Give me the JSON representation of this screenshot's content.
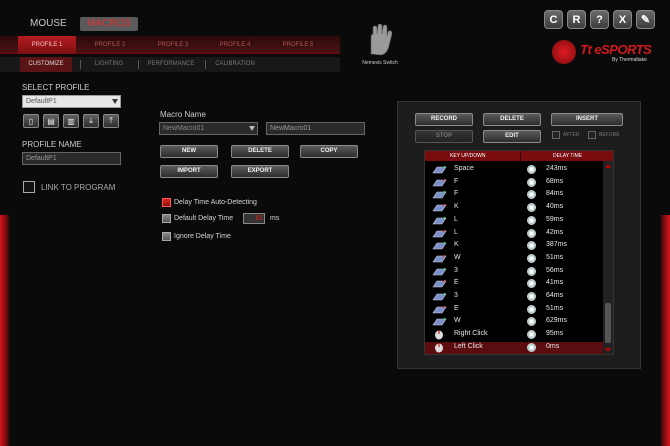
{
  "top_modes": {
    "mouse": "MOUSE",
    "macros": "MACROS"
  },
  "window_buttons": {
    "refresh": "C",
    "restore": "R",
    "help": "?",
    "close": "X",
    "tools": "✎"
  },
  "profiles": [
    "PROFILE 1",
    "PROFILE 2",
    "PROFILE 3",
    "PROFILE 4",
    "PROFILE 5"
  ],
  "subnav": [
    "CUSTOMIZE",
    "LIGHTING",
    "PERFORMANCE",
    "CALIBRATION"
  ],
  "device": {
    "name": "Nemesis Switch"
  },
  "brand": {
    "name": "Tt eSPORTS",
    "sub": "By Thermaltake"
  },
  "left": {
    "select_profile_label": "SELECT PROFILE",
    "select_profile_value": "DefaultP1",
    "profile_name_label": "PROFILE NAME",
    "profile_name_value": "DefaultP1",
    "link_label": "LINK TO PROGRAM"
  },
  "macro": {
    "name_label": "Macro Name",
    "select_value": "NewMacro01",
    "name_value": "NewMacro01",
    "buttons": {
      "new": "NEW",
      "delete": "DELETE",
      "copy": "COPY",
      "import": "IMPORT",
      "export": "EXPORT"
    },
    "options": {
      "auto": "Delay Time Auto-Detecting",
      "default": "Default Delay Time",
      "ignore": "Ignore Delay Time",
      "default_value": "10",
      "unit": "ms"
    }
  },
  "recorder": {
    "record": "RECORD",
    "delete": "DELETE",
    "insert": "INSERT",
    "stop": "STOP",
    "edit": "EDIT",
    "after": "AFTER",
    "before": "BEFORE",
    "col_key": "KEY UP/DOWN",
    "col_delay": "DELAY TIME",
    "events": [
      {
        "key": "Space",
        "delay": "243ms"
      },
      {
        "key": "F",
        "delay": "68ms"
      },
      {
        "key": "F",
        "delay": "84ms"
      },
      {
        "key": "K",
        "delay": "40ms"
      },
      {
        "key": "L",
        "delay": "59ms"
      },
      {
        "key": "L",
        "delay": "42ms"
      },
      {
        "key": "K",
        "delay": "387ms"
      },
      {
        "key": "W",
        "delay": "51ms"
      },
      {
        "key": "3",
        "delay": "56ms"
      },
      {
        "key": "E",
        "delay": "41ms"
      },
      {
        "key": "3",
        "delay": "64ms"
      },
      {
        "key": "E",
        "delay": "51ms"
      },
      {
        "key": "W",
        "delay": "629ms"
      },
      {
        "key": "Right Click",
        "delay": "95ms"
      },
      {
        "key": "Left Click",
        "delay": "0ms"
      }
    ]
  }
}
